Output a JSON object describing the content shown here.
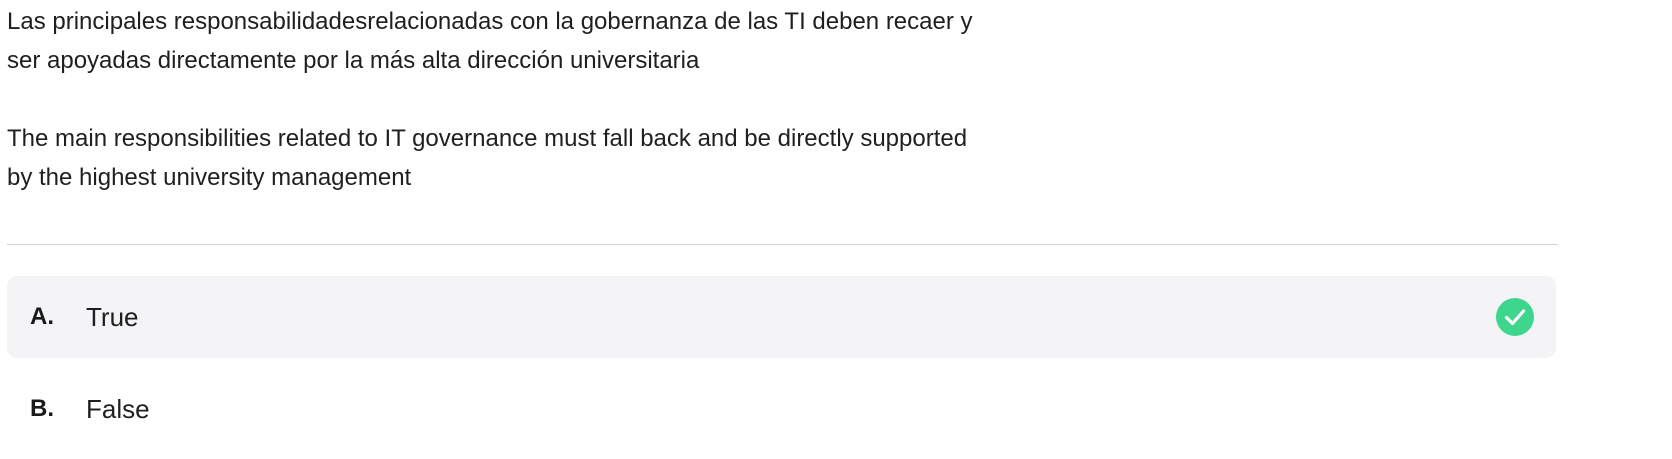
{
  "question": {
    "spanish": "Las principales responsabilidadesrelacionadas con la gobernanza de las TI deben recaer y\nser apoyadas directamente por la más alta dirección universitaria",
    "english": "The main responsibilities related to IT governance must fall back and be directly supported\nby the highest university management"
  },
  "options": [
    {
      "letter": "A.",
      "text": "True",
      "selected": true,
      "correct": true
    },
    {
      "letter": "B.",
      "text": "False",
      "selected": false,
      "correct": false
    }
  ],
  "colors": {
    "correct_check": "#3dd68c",
    "selected_bg": "#f4f4f6",
    "divider": "#d2d2d6"
  },
  "icons": {
    "correct": "check-circle-icon"
  }
}
